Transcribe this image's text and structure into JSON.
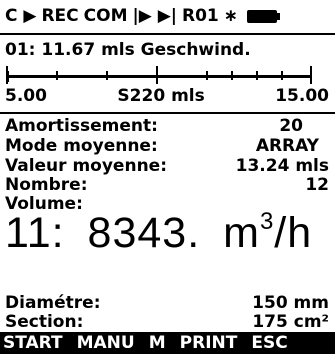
{
  "status": {
    "channel_indicator": "C ▶",
    "rec": "REC",
    "com": "COM",
    "playback": "|▶ ▶|",
    "rom": "R01",
    "star": "∗"
  },
  "channel": {
    "line": "01: 11.67 mls  Geschwind."
  },
  "scale": {
    "min": "5.00",
    "center": "S220 mls",
    "max": "15.00",
    "fill_fraction": 0.5
  },
  "params": [
    {
      "label": "Amortissement:",
      "value": "20"
    },
    {
      "label": "Mode moyenne:",
      "value": "ARRAY"
    },
    {
      "label": "Valeur moyenne:",
      "value": "13.24 mls"
    },
    {
      "label": "Nombre:",
      "value": "12"
    },
    {
      "label": "Volume:",
      "value": ""
    }
  ],
  "main_reading": {
    "prefix": "11:",
    "value": "8343.",
    "unit": "m",
    "unit_exp": "3",
    "unit_suffix": "/h"
  },
  "dims": [
    {
      "label": "Diamétre:",
      "value": "150 mm"
    },
    {
      "label": "Section:",
      "value": "175 cm²"
    }
  ],
  "softkeys": [
    "START",
    "MANU",
    "M",
    "PRINT",
    "ESC"
  ]
}
